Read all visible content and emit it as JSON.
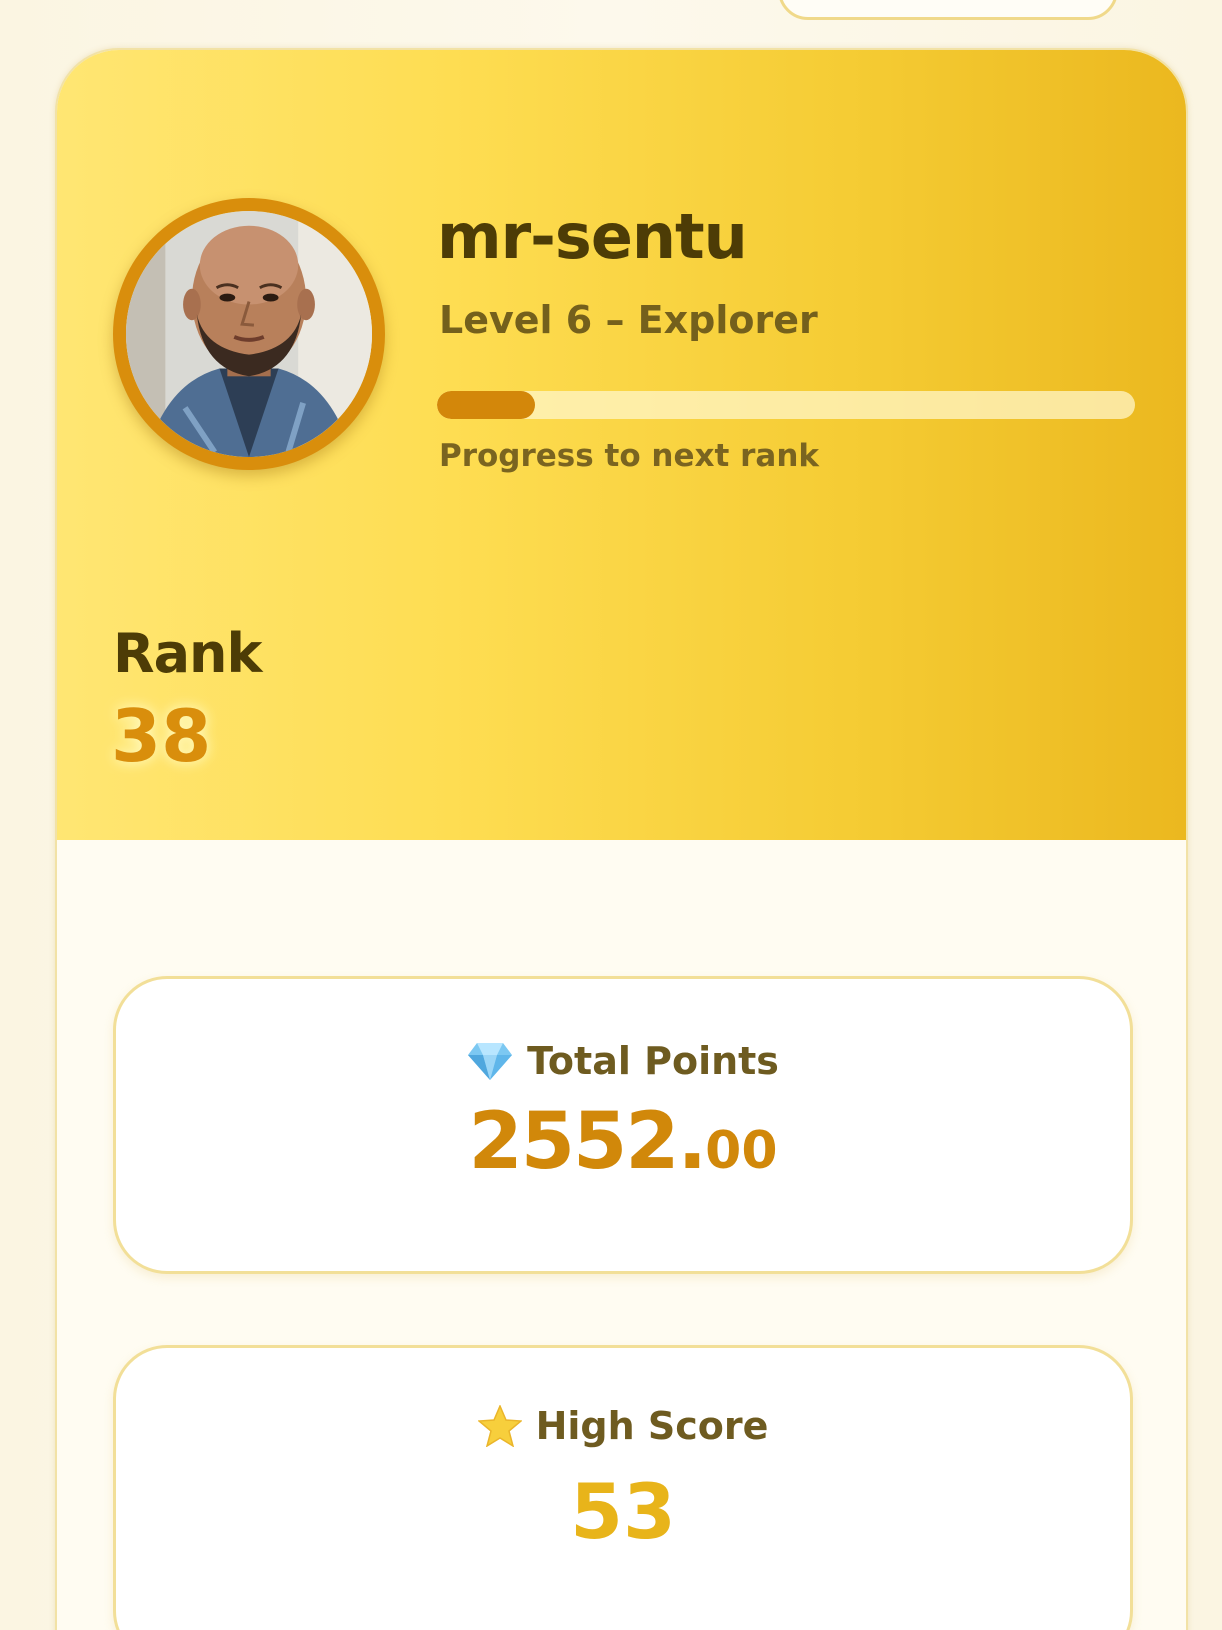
{
  "profile": {
    "username": "mr-sentu",
    "level_text": "Level 6 – Explorer",
    "progress_fraction": 0.14,
    "progress_label": "Progress to next rank",
    "rank_label": "Rank",
    "rank_value": "38"
  },
  "stats": {
    "total_points": {
      "icon": "diamond-icon",
      "label": "Total Points",
      "integer_part": "2552.",
      "decimal_part": "00"
    },
    "high_score": {
      "icon": "star-icon",
      "label": "High Score",
      "value": "53"
    }
  },
  "colors": {
    "hero_gradient_start": "#ffe673",
    "hero_gradient_end": "#ebb81f",
    "accent": "#d98e0c",
    "text_dark": "#4d3c06"
  }
}
